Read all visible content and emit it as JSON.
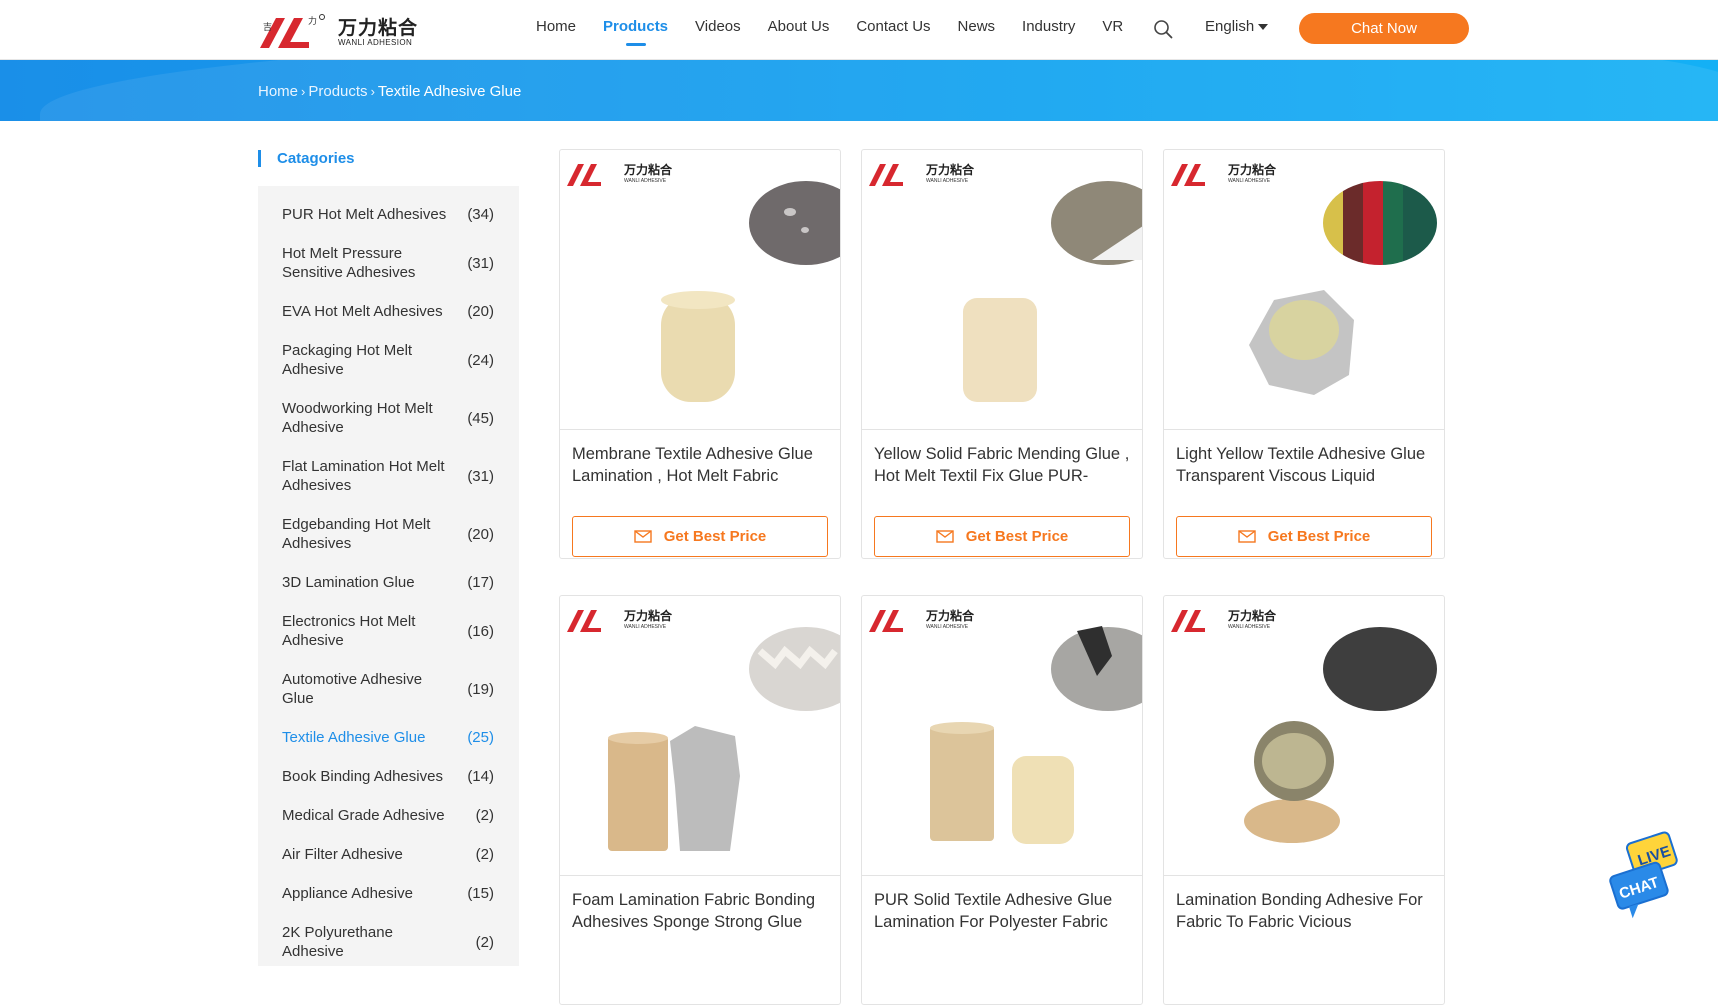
{
  "header": {
    "logo_cn": "万力粘合",
    "logo_en": "WANLI ADHESION",
    "nav": [
      "Home",
      "Products",
      "Videos",
      "About Us",
      "Contact Us",
      "News",
      "Industry",
      "VR"
    ],
    "language": "English",
    "chat_button": "Chat Now"
  },
  "breadcrumb": {
    "home": "Home",
    "products": "Products",
    "current": "Textile Adhesive Glue"
  },
  "sidebar": {
    "title": "Catagories",
    "items": [
      {
        "label": "PUR Hot Melt Adhesives",
        "count": "(34)"
      },
      {
        "label": "Hot Melt Pressure Sensitive Adhesives",
        "count": "(31)"
      },
      {
        "label": "EVA Hot Melt Adhesives",
        "count": "(20)"
      },
      {
        "label": "Packaging Hot Melt Adhesive",
        "count": "(24)"
      },
      {
        "label": "Woodworking Hot Melt Adhesive",
        "count": "(45)"
      },
      {
        "label": "Flat Lamination Hot Melt Adhesives",
        "count": "(31)"
      },
      {
        "label": "Edgebanding Hot Melt Adhesives",
        "count": "(20)"
      },
      {
        "label": "3D Lamination Glue",
        "count": "(17)"
      },
      {
        "label": "Electronics Hot Melt Adhesive",
        "count": "(16)"
      },
      {
        "label": "Automotive Adhesive Glue",
        "count": "(19)"
      },
      {
        "label": "Textile Adhesive Glue",
        "count": "(25)"
      },
      {
        "label": "Book Binding Adhesives",
        "count": "(14)"
      },
      {
        "label": "Medical Grade Adhesive",
        "count": "(2)"
      },
      {
        "label": "Air Filter Adhesive",
        "count": "(2)"
      },
      {
        "label": "Appliance Adhesive",
        "count": "(15)"
      },
      {
        "label": "2K Polyurethane Adhesive",
        "count": "(2)"
      }
    ]
  },
  "product_card": {
    "logo_cn": "万力粘合",
    "logo_en": "WANLI ADHESIVE",
    "button": "Get Best Price"
  },
  "products": [
    {
      "title": "Membrane Textile Adhesive Glue Lamination , Hot Melt Fabric"
    },
    {
      "title": "Yellow Solid Fabric Mending Glue , Hot Melt Textil Fix Glue PUR-"
    },
    {
      "title": "Light Yellow Textile Adhesive Glue Transparent Viscous Liquid"
    },
    {
      "title": "Foam Lamination Fabric Bonding Adhesives Sponge Strong Glue"
    },
    {
      "title": "PUR Solid Textile Adhesive Glue Lamination For Polyester Fabric"
    },
    {
      "title": "Lamination Bonding Adhesive For Fabric To Fabric Vicious"
    }
  ],
  "livechat": {
    "line1": "LIVE",
    "line2": "CHAT"
  },
  "colors": {
    "accent": "#1e8ee8",
    "orange": "#f6781f",
    "logo_red": "#d7282f"
  }
}
